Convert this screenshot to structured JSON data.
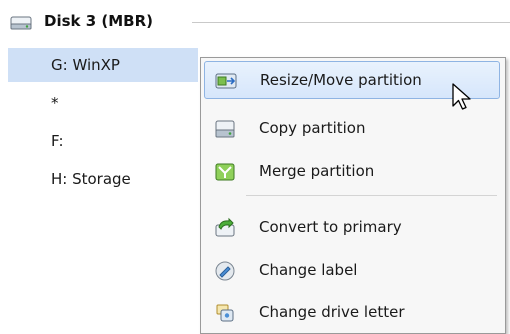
{
  "disk": {
    "title": "Disk 3 (MBR)"
  },
  "partitions": [
    {
      "label": "G: WinXP",
      "selected": true
    },
    {
      "label": "*",
      "selected": false
    },
    {
      "label": "F:",
      "selected": false
    },
    {
      "label": "H: Storage",
      "selected": false
    }
  ],
  "context_menu": {
    "items": [
      {
        "label": "Resize/Move partition",
        "icon": "resize-move-icon",
        "highlighted": true
      },
      {
        "label": "Copy partition",
        "icon": "copy-partition-icon"
      },
      {
        "label": "Merge partition",
        "icon": "merge-partition-icon"
      },
      {
        "label": "Convert to primary",
        "icon": "convert-primary-icon"
      },
      {
        "label": "Change label",
        "icon": "change-label-icon"
      },
      {
        "label": "Change drive letter",
        "icon": "change-drive-letter-icon"
      }
    ]
  },
  "colors": {
    "selection": "#cfe0f6",
    "menu_highlight": "#d6e6fb",
    "menu_background": "#f7f7f7"
  }
}
